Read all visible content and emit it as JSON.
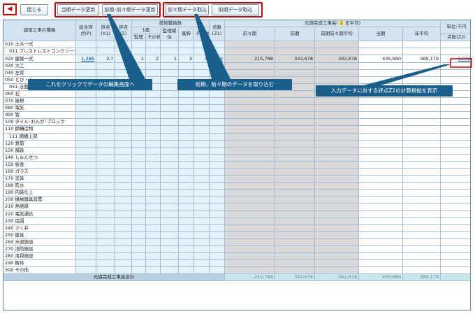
{
  "toolbar": {
    "back": "◀",
    "close": "閉じる",
    "b1": "当期データ更新",
    "b2": "前期･前々期データ更新",
    "b3": "前々期データ取込",
    "b4": "前期データ取込"
  },
  "header": {
    "type": "建設工事の種類",
    "total": "総合評点(P)",
    "x1": "評点(X1)",
    "z": "評点(Z)",
    "engineers": "技術職員数",
    "lvl1": "1級",
    "supervisor": "監理",
    "other": "その他",
    "sup_assist": "監理補佐",
    "basic": "基幹",
    "other2": "その他",
    "z1": "点数(Z1)",
    "completed_pre": "元請完成工事高(",
    "completed_n": "2",
    "completed_post": "年平均)",
    "unit": "単位:千円",
    "prev2": "前々期",
    "prev": "前期",
    "avg": "前期前々期平均",
    "cur": "当期",
    "yavg": "年平均",
    "z2": "点数(Z2)"
  },
  "rows": [
    {
      "n": "010 土木一式"
    },
    {
      "n": "011 プレストレストコンクリート",
      "s": 1
    },
    {
      "n": "020 建築一式",
      "p": "1,286",
      "x1": "2,?",
      "z": "?6",
      "a": "1",
      "b": "2",
      "c": "1",
      "d": "3",
      "e": "3",
      "z1": "859",
      "f": "215,788",
      "g": "342,678",
      "h": "342,678",
      "i": "435,680",
      "j": "389,179",
      "z2": "1,045"
    },
    {
      "n": "030 大工"
    },
    {
      "n": "040 左官"
    },
    {
      "n": "050 とび・土"
    },
    {
      "n": "051 法面",
      "s": 1
    },
    {
      "n": "060 石"
    },
    {
      "n": "070 屋根"
    },
    {
      "n": "080 電気"
    },
    {
      "n": "090 管"
    },
    {
      "n": "100 タイル･れんが･ブロック"
    },
    {
      "n": "110 鋼構造物"
    },
    {
      "n": "111 鋼橋上部",
      "s": 1
    },
    {
      "n": "120 鉄筋"
    },
    {
      "n": "130 舗装"
    },
    {
      "n": "140 しゅんせつ"
    },
    {
      "n": "150 板金"
    },
    {
      "n": "160 ガラス"
    },
    {
      "n": "170 塗装"
    },
    {
      "n": "180 防水"
    },
    {
      "n": "190 内装仕上"
    },
    {
      "n": "200 機械器具設置"
    },
    {
      "n": "210 熱絶縁"
    },
    {
      "n": "220 電気通信"
    },
    {
      "n": "230 造園"
    },
    {
      "n": "240 さく井"
    },
    {
      "n": "250 建具"
    },
    {
      "n": "260 水道施設"
    },
    {
      "n": "270 消防施設"
    },
    {
      "n": "280 清掃施設"
    },
    {
      "n": "290 解体"
    },
    {
      "n": "300 その他"
    }
  ],
  "totals": {
    "label": "元請完成工事高合計",
    "f": "215,788",
    "g": "342,678",
    "h": "342,678",
    "i": "435,680",
    "j": "389,179"
  },
  "callouts": {
    "c1": "これをクリックでデータの編集画面へ",
    "c2": "前期、前々期のデータを取り込む",
    "c3": "入力データに対する評点Z2の計算根拠を表示"
  },
  "colors": {
    "accent": "#185f8c",
    "highlight": "#d40000",
    "header": "#d3e3f0",
    "lightblue": "#e4f3fb",
    "gray": "#d9d9d9"
  }
}
